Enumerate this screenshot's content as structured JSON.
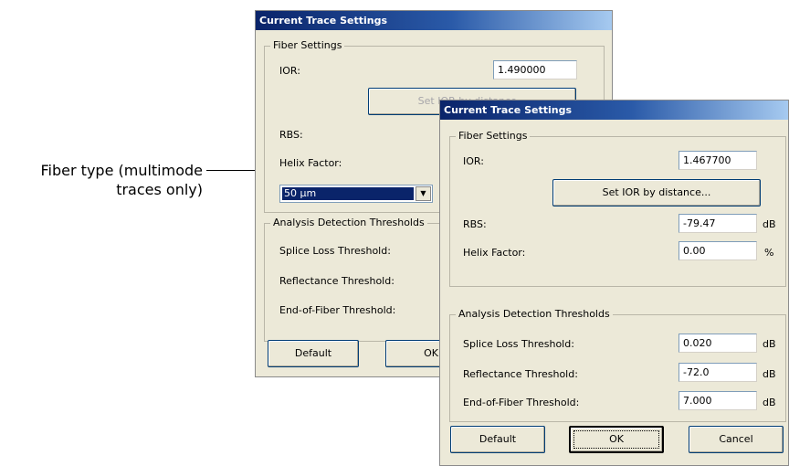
{
  "callout": {
    "line1": "Fiber type (multimode",
    "line2": "traces only)"
  },
  "back_dialog": {
    "title": "Current Trace Settings",
    "fiber_settings": {
      "legend": "Fiber Settings",
      "ior_label": "IOR:",
      "ior_value": "1.490000",
      "set_ior_button": "Set IOR by distance...",
      "rbs_label": "RBS:",
      "helix_label": "Helix Factor:",
      "fiber_type_value": "50 µm"
    },
    "analysis": {
      "legend": "Analysis Detection Thresholds",
      "splice_label": "Splice Loss Threshold:",
      "reflectance_label": "Reflectance Threshold:",
      "eof_label": "End-of-Fiber Threshold:"
    },
    "buttons": {
      "default": "Default",
      "ok": "OK"
    }
  },
  "front_dialog": {
    "title": "Current Trace Settings",
    "fiber_settings": {
      "legend": "Fiber Settings",
      "ior_label": "IOR:",
      "ior_value": "1.467700",
      "set_ior_button": "Set IOR by distance...",
      "rbs_label": "RBS:",
      "rbs_value": "-79.47",
      "rbs_unit": "dB",
      "helix_label": "Helix Factor:",
      "helix_value": "0.00",
      "helix_unit": "%"
    },
    "analysis": {
      "legend": "Analysis Detection Thresholds",
      "splice_label": "Splice Loss Threshold:",
      "splice_value": "0.020",
      "splice_unit": "dB",
      "reflectance_label": "Reflectance Threshold:",
      "reflectance_value": "-72.0",
      "reflectance_unit": "dB",
      "eof_label": "End-of-Fiber Threshold:",
      "eof_value": "7.000",
      "eof_unit": "dB"
    },
    "buttons": {
      "default": "Default",
      "ok": "OK",
      "cancel": "Cancel"
    }
  }
}
